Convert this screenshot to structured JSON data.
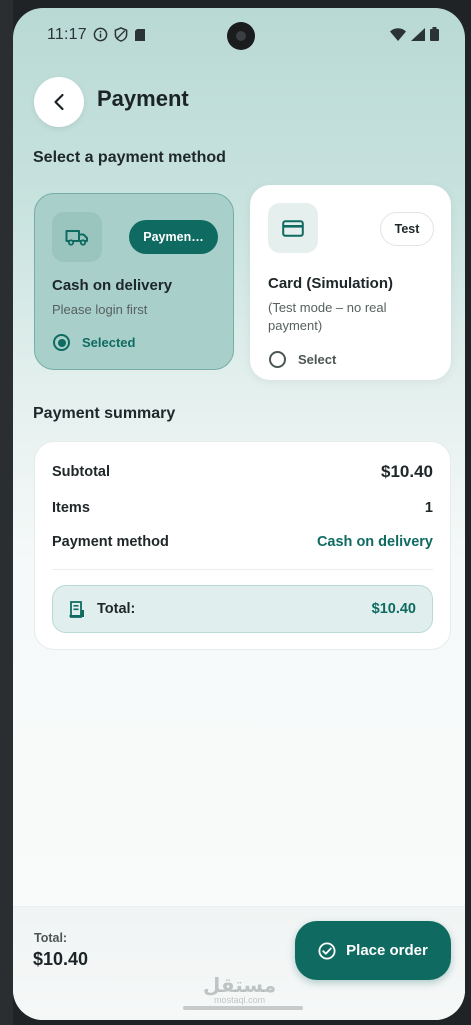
{
  "status_bar": {
    "time": "11:17"
  },
  "header": {
    "title": "Payment"
  },
  "payment_methods": {
    "section_title": "Select a payment method",
    "items": [
      {
        "name": "Cash on delivery",
        "description": "Please login first",
        "badge": "Paymen…",
        "radio_label": "Selected",
        "selected": true,
        "icon": "truck-icon"
      },
      {
        "name": "Card (Simulation)",
        "description": "(Test mode – no real payment)",
        "badge": "Test",
        "radio_label": "Select",
        "selected": false,
        "icon": "credit-card-icon"
      }
    ]
  },
  "summary": {
    "section_title": "Payment summary",
    "subtotal_label": "Subtotal",
    "subtotal_value": "$10.40",
    "items_label": "Items",
    "items_value": "1",
    "method_label": "Payment method",
    "method_value": "Cash on delivery",
    "total_label": "Total:",
    "total_value": "$10.40"
  },
  "bottom_bar": {
    "total_label": "Total:",
    "total_value": "$10.40",
    "place_order_label": "Place order"
  },
  "watermark": {
    "arabic": "مستقل",
    "latin": "mostaql.com"
  },
  "colors": {
    "accent": "#0f6b61",
    "selected_card_bg": "#a9cfca",
    "total_box_bg": "#e0efed"
  }
}
